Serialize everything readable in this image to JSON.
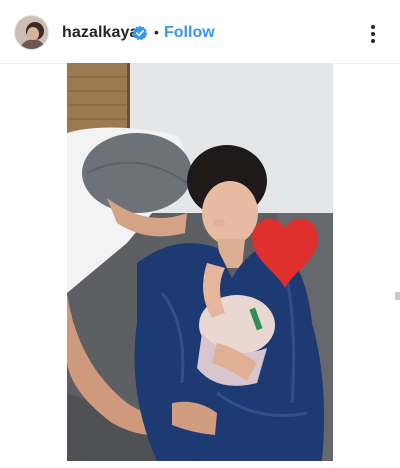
{
  "header": {
    "username": "hazalkaya",
    "separator": "•",
    "follow_label": "Follow"
  },
  "icons": {
    "verified": "verified-badge-icon",
    "more": "more-options-icon"
  },
  "colors": {
    "follow": "#3897f0",
    "verified": "#3897f0",
    "heart": "#e0302e",
    "robe": "#1d3a72"
  }
}
